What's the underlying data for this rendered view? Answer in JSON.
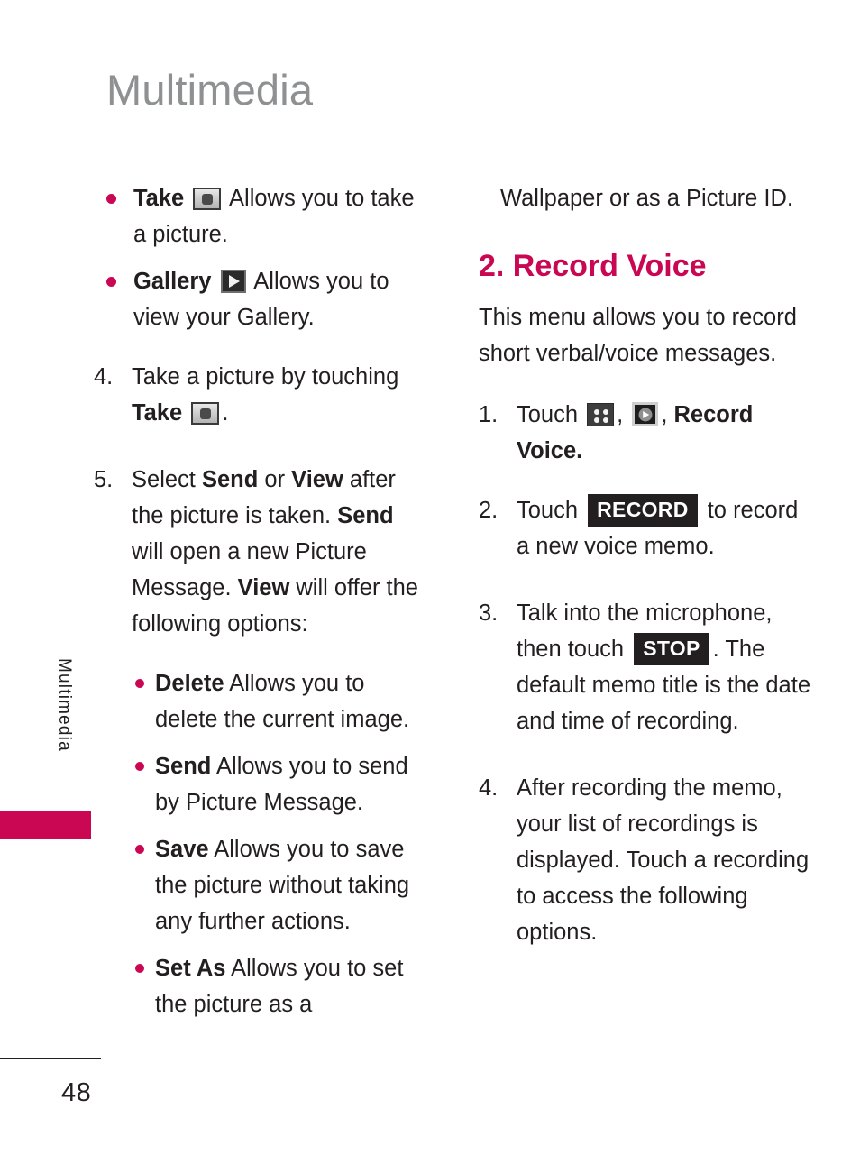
{
  "page": {
    "title": "Multimedia",
    "side_tab_label": "Multimedia",
    "page_number": "48"
  },
  "colors": {
    "accent": "#c90752",
    "title_gray": "#8e9092",
    "body_text": "#231f20",
    "keycap_bg": "#231f20"
  },
  "left_column": {
    "bullets": [
      {
        "label": "Take",
        "icon": "camera-icon",
        "text": "Allows you to take a picture."
      },
      {
        "label": "Gallery",
        "icon": "gallery-play-icon",
        "text": "Allows you to view your Gallery."
      }
    ],
    "step_4": {
      "number": "4.",
      "text_before": "Take a picture by touching",
      "bold_label": "Take",
      "icon": "camera-icon",
      "text_after": "."
    },
    "step_5": {
      "number": "5.",
      "parts": [
        {
          "text": "Select ",
          "bold": false
        },
        {
          "text": "Send",
          "bold": true
        },
        {
          "text": " or ",
          "bold": false
        },
        {
          "text": "View",
          "bold": true
        },
        {
          "text": " after the picture is taken. ",
          "bold": false
        },
        {
          "text": "Send",
          "bold": true
        },
        {
          "text": " will open a new Picture Message. ",
          "bold": false
        },
        {
          "text": "View",
          "bold": true
        },
        {
          "text": " will offer the following options:",
          "bold": false
        }
      ]
    },
    "sub_options": [
      {
        "label": "Delete",
        "text": "Allows you to delete the current image."
      },
      {
        "label": "Send",
        "text": "Allows you to send by Picture Message."
      },
      {
        "label": "Save",
        "text": "Allows you to save the picture without taking any further actions."
      },
      {
        "label": "Set As",
        "text": "Allows you to set the picture as a"
      }
    ]
  },
  "right_column": {
    "continuation": "Wallpaper or as a Picture ID.",
    "heading": "2. Record Voice",
    "intro": "This menu allows you to record short verbal/voice messages.",
    "steps": [
      {
        "number": "1.",
        "text_before": "Touch",
        "icon_1": "menu-grid-icon",
        "sep_1": ",",
        "icon_2": "media-play-icon",
        "sep_2": ",",
        "bold_label": "Record Voice",
        "text_after": "."
      },
      {
        "number": "2.",
        "text_before": "Touch",
        "keycap": "RECORD",
        "text_after": "to record a new voice memo."
      },
      {
        "number": "3.",
        "text_before": "Talk into the microphone, then touch",
        "keycap": "STOP",
        "text_after": ". The default memo title is the date and time of recording."
      },
      {
        "number": "4.",
        "text": "After recording the memo, your list of recordings is displayed. Touch a recording to access the following options."
      }
    ]
  }
}
